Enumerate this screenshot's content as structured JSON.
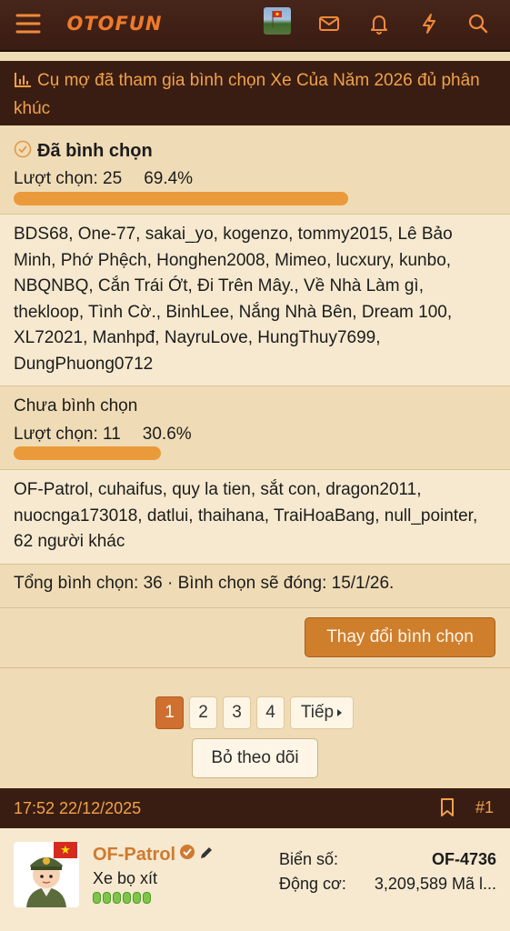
{
  "header": {
    "logo_text": "OTOFUN",
    "icons": [
      "menu-icon",
      "envelope-icon",
      "bell-icon",
      "lightning-icon",
      "search-icon"
    ]
  },
  "poll": {
    "title": "Cụ mợ đã tham gia bình chọn Xe Của Năm 2026 đủ phân khúc",
    "responses": [
      {
        "label": "Đã bình chọn",
        "votes_label": "Lượt chọn: 25",
        "percent_label": "69.4%",
        "fraction": 0.694,
        "voters": "BDS68, One-77, sakai_yo, kogenzo, tommy2015, Lê Bảo Minh, Phớ Phệch, Honghen2008, Mimeo, lucxury, kunbo, NBQNBQ, Cắn Trái Ớt, Đi Trên Mây., Về Nhà Làm gì, thekloop, Tình Cờ., BinhLee, Nắng Nhà Bên, Dream 100, XL72021, Manhpđ, NayruLove, HungThuy7699, DungPhuong0712"
      },
      {
        "label": "Chưa bình chọn",
        "votes_label": "Lượt chọn: 11",
        "percent_label": "30.6%",
        "fraction": 0.306,
        "voters": "OF-Patrol, cuhaifus, quy la tien, sắt con, dragon2011, nuocnga173018, datlui, thaihana, TraiHoaBang, null_pointer, 62 người khác"
      }
    ],
    "footer": "Tổng bình chọn: 36 · Bình chọn sẽ đóng: 15/1/26.",
    "change_vote_label": "Thay đổi bình chọn"
  },
  "pagination": {
    "pages": [
      "1",
      "2",
      "3",
      "4"
    ],
    "current": "1",
    "next_label": "Tiếp",
    "unwatch_label": "Bỏ theo dõi"
  },
  "post": {
    "timestamp": "17:52 22/12/2025",
    "number": "#1",
    "author": {
      "name": "OF-Patrol",
      "title": "Xe bọ xít",
      "reputation_dots": 6,
      "plate_label": "Biển số:",
      "plate_value": "OF-4736",
      "engine_label": "Động cơ:",
      "engine_value": "3,209,589 Mã l..."
    }
  },
  "colors": {
    "header_bg": "#3a1d12",
    "accent_orange": "#ea9a3a",
    "button_orange": "#cf7e2c",
    "page_bg": "#efdcb6"
  }
}
